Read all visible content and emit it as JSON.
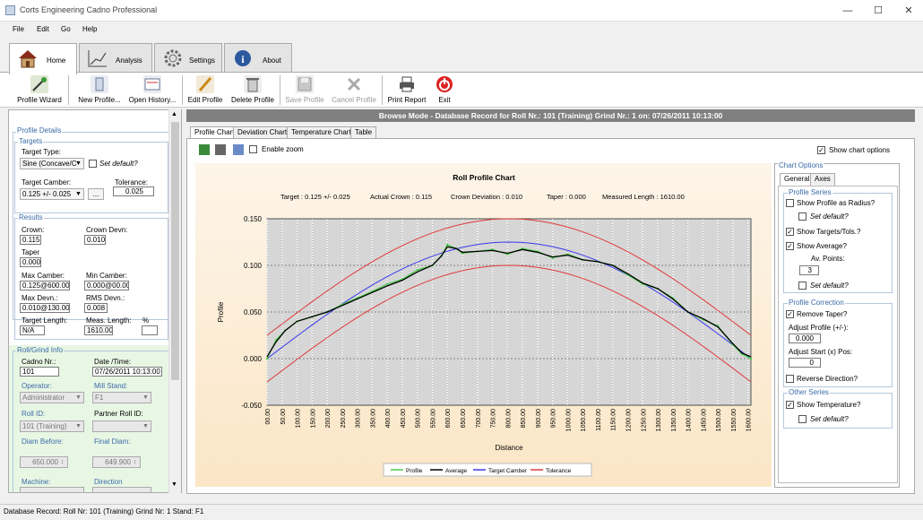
{
  "window": {
    "title": "Corts Engineering Cadno Professional"
  },
  "menu": [
    "File",
    "Edit",
    "Go",
    "Help"
  ],
  "ribbon_tabs": [
    {
      "label": "Home",
      "icon": "house-icon"
    },
    {
      "label": "Analysis",
      "icon": "chart-line-icon"
    },
    {
      "label": "Settings",
      "icon": "gear-icon"
    },
    {
      "label": "About",
      "icon": "info-icon"
    }
  ],
  "toolbar": [
    {
      "label": "Profile Wizard",
      "icon": "wizard-wand-icon",
      "enabled": true
    },
    {
      "label": "New Profile...",
      "icon": "new-profile-icon",
      "enabled": true
    },
    {
      "label": "Open History...",
      "icon": "open-history-icon",
      "enabled": true
    },
    {
      "label": "Edit Profile",
      "icon": "pencil-icon",
      "enabled": true
    },
    {
      "label": "Delete Profile",
      "icon": "trash-icon",
      "enabled": true
    },
    {
      "label": "Save Profile",
      "icon": "floppy-icon",
      "enabled": false
    },
    {
      "label": "Cancel Profile",
      "icon": "cancel-x-icon",
      "enabled": false
    },
    {
      "label": "Print Report",
      "icon": "printer-icon",
      "enabled": true
    },
    {
      "label": "Exit",
      "icon": "power-icon",
      "enabled": true
    }
  ],
  "browse_band": "Browse Mode - Database Record for Roll Nr.: 101 (Training) Grind Nr.: 1 on: 07/26/2011 10:13:00",
  "left": {
    "profile_details": "Profile Details",
    "targets": "Targets",
    "target_type_label": "Target Type:",
    "target_type_value": "Sine (Concave/C",
    "set_default": "Set default?",
    "target_camber_label": "Target Camber:",
    "target_camber_value": "0.125  +/- 0.025",
    "tolerance_label": "Tolerance:",
    "tolerance_value": "0.025",
    "ellipsis": "...",
    "results": "Results",
    "crown_label": "Crown:",
    "crown_value": "0.115",
    "crown_devn_label": "Crown Devn:",
    "crown_devn_value": "0.010",
    "taper_label": "Taper",
    "taper_value": "0.000",
    "max_camber_label": "Max Camber:",
    "max_camber_value": "0.125@600.00",
    "min_camber_label": "Min Camber:",
    "min_camber_value": "0.000@00.00",
    "max_devn_label": "Max Devn.:",
    "max_devn_value": "0.010@130.00",
    "rms_devn_label": "RMS  Devn.:",
    "rms_devn_value": "0.008",
    "target_length_label": "Target Length:",
    "target_length_value": "N/A",
    "meas_length_label": "Meas. Length:",
    "meas_length_value": "1610.00",
    "pct_label": "%",
    "roll_grind_info": "Roll/Grind Info",
    "cadno_label": "Cadno Nr.:",
    "cadno_value": "101",
    "datetime_label": "Date /Time:",
    "datetime_value": "07/26/2011 10:13:00",
    "operator_label": "Operator:",
    "operator_value": "Administrator",
    "mill_stand_label": "Mill Stand:",
    "mill_stand_value": "F1",
    "roll_id_label": "Roll ID:",
    "roll_id_value": "101 (Training)",
    "partner_label": "Partner Roll ID:",
    "partner_value": "",
    "diam_before_label": "Diam Before:",
    "diam_before_value": "650.000",
    "final_diam_label": "Final Diam:",
    "final_diam_value": "649.900",
    "machine_label": "Machine:",
    "direction_label": "Direction"
  },
  "chart_tabs": [
    "Profile Chart",
    "Deviation Chart",
    "Temperature Chart",
    "Table"
  ],
  "chart_toolbar": {
    "enable_zoom": "Enable zoom",
    "show_options": "Show chart options"
  },
  "chart_options": {
    "title": "Chart Options",
    "tabs": [
      "General",
      "Axes"
    ],
    "profile_series": "Profile Series",
    "show_radius": "Show Profile as Radius?",
    "set_default": "Set default?",
    "show_targets": "Show Targets/Tols.?",
    "show_average": "Show Average?",
    "av_points_label": "Av. Points:",
    "av_points_value": "3",
    "profile_correction": "Profile Correction",
    "remove_taper": "Remove Taper?",
    "adjust_profile_label": "Adjust Profile (+/-):",
    "adjust_profile_value": "0.000",
    "adjust_start_label": "Adjust Start (x) Pos:",
    "adjust_start_value": "0",
    "reverse_direction": "Reverse Direction?",
    "other_series": "Other Series",
    "show_temperature": "Show Temperature?"
  },
  "status_bar": "Database Record: Roll Nr: 101 (Training) Grind Nr: 1  Stand: F1",
  "colors": {
    "profile": "#4cc84c",
    "average": "#000000",
    "target": "#3a3aee",
    "tolerance": "#e03a3a"
  },
  "chart_data": {
    "type": "line",
    "title": "Roll Profile Chart",
    "subtitle_items": [
      "Target : 0.125 +/- 0.025",
      "Actual Crown : 0.115",
      "Crown Deviation : 0.010",
      "Taper : 0.000",
      "Measured Length : 1610.00"
    ],
    "xlabel": "Distance",
    "ylabel": "Profile",
    "xlim": [
      0,
      1610
    ],
    "ylim": [
      -0.05,
      0.15
    ],
    "yticks": [
      "0.150",
      "0.100",
      "0.050",
      "0.000",
      "-0.050"
    ],
    "ytick_values": [
      0.15,
      0.1,
      0.05,
      0,
      -0.05
    ],
    "xticks": [
      "00.00",
      "50.00",
      "100.00",
      "150.00",
      "200.00",
      "250.00",
      "300.00",
      "350.00",
      "400.00",
      "450.00",
      "500.00",
      "550.00",
      "600.00",
      "650.00",
      "700.00",
      "750.00",
      "800.00",
      "850.00",
      "900.00",
      "950.00",
      "1000.00",
      "1050.00",
      "1100.00",
      "1150.00",
      "1200.00",
      "1250.00",
      "1300.00",
      "1350.00",
      "1400.00",
      "1450.00",
      "1500.00",
      "1550.00",
      "1600.00"
    ],
    "legend": [
      "Profile",
      "Average",
      "Target Camber",
      "Tolerance"
    ],
    "legend_position": "bottom",
    "grid": true,
    "series": [
      {
        "name": "Profile",
        "x": [
          0,
          30,
          60,
          100,
          150,
          200,
          250,
          300,
          350,
          400,
          450,
          500,
          550,
          580,
          600,
          630,
          650,
          700,
          750,
          800,
          850,
          900,
          950,
          1000,
          1050,
          1100,
          1150,
          1200,
          1250,
          1300,
          1350,
          1400,
          1450,
          1500,
          1550,
          1580,
          1610
        ],
        "values": [
          0.0,
          0.02,
          0.03,
          0.04,
          0.045,
          0.05,
          0.058,
          0.065,
          0.072,
          0.08,
          0.085,
          0.095,
          0.1,
          0.11,
          0.122,
          0.118,
          0.113,
          0.115,
          0.117,
          0.112,
          0.118,
          0.115,
          0.108,
          0.112,
          0.106,
          0.104,
          0.1,
          0.09,
          0.08,
          0.075,
          0.065,
          0.05,
          0.042,
          0.035,
          0.015,
          0.005,
          0.0
        ]
      },
      {
        "name": "Average",
        "x": [
          0,
          30,
          60,
          100,
          150,
          200,
          250,
          300,
          350,
          400,
          450,
          500,
          550,
          580,
          600,
          630,
          650,
          700,
          750,
          800,
          850,
          900,
          950,
          1000,
          1050,
          1100,
          1150,
          1200,
          1250,
          1300,
          1350,
          1400,
          1450,
          1500,
          1550,
          1580,
          1610
        ],
        "values": [
          0.002,
          0.018,
          0.03,
          0.04,
          0.045,
          0.05,
          0.057,
          0.064,
          0.071,
          0.078,
          0.084,
          0.093,
          0.1,
          0.11,
          0.12,
          0.118,
          0.114,
          0.115,
          0.116,
          0.113,
          0.117,
          0.114,
          0.109,
          0.111,
          0.106,
          0.104,
          0.1,
          0.091,
          0.081,
          0.075,
          0.064,
          0.05,
          0.043,
          0.034,
          0.016,
          0.006,
          0.002
        ]
      },
      {
        "name": "Target Camber",
        "function": "sine",
        "crown": 0.125
      },
      {
        "name": "Tolerance",
        "function": "sine_band",
        "crown": 0.125,
        "band": 0.025
      }
    ]
  }
}
